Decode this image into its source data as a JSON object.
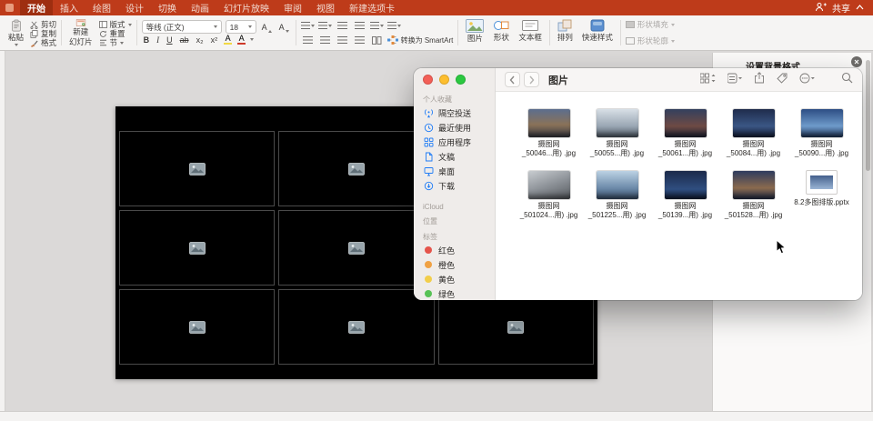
{
  "tabbar": {
    "tabs": [
      "开始",
      "插入",
      "绘图",
      "设计",
      "切换",
      "动画",
      "幻灯片放映",
      "审阅",
      "视图",
      "新建选项卡"
    ],
    "share": "共享"
  },
  "ribbon": {
    "paste": "粘贴",
    "cut": "剪切",
    "copy": "复制",
    "format_painter": "格式",
    "new_slide_line1": "新建",
    "new_slide_line2": "幻灯片",
    "layout": "版式",
    "reset": "重置",
    "section": "节",
    "font_name": "等线 (正文)",
    "font_size": "18",
    "size_up": "A",
    "size_down": "A",
    "bold": "B",
    "italic": "I",
    "underline": "U",
    "strike": "ab",
    "subscript": "x₂",
    "superscript": "x²",
    "highlight": "A",
    "font_color": "A",
    "smartart": "转换为 SmartArt",
    "picture": "图片",
    "shapes": "形状",
    "textbox": "文本框",
    "arrange": "排列",
    "quick_styles": "快速样式",
    "shape_fill": "形状填充",
    "shape_outline": "形状轮廓"
  },
  "finder": {
    "title": "图片",
    "sidebar": {
      "favorites_header": "个人收藏",
      "favorites": [
        {
          "label": "隔空投送"
        },
        {
          "label": "最近使用"
        },
        {
          "label": "应用程序"
        },
        {
          "label": "文稿"
        },
        {
          "label": "桌面"
        },
        {
          "label": "下载"
        }
      ],
      "icloud_header": "iCloud",
      "locations_header": "位置",
      "tags_header": "标签",
      "tags": [
        {
          "label": "红色",
          "color": "#E5544B"
        },
        {
          "label": "橙色",
          "color": "#F0A143"
        },
        {
          "label": "黄色",
          "color": "#F2CE4B"
        },
        {
          "label": "绿色",
          "color": "#57C255"
        }
      ]
    },
    "files": [
      {
        "name_line1": "摄图网",
        "name_line2": "_50046...用) .jpg"
      },
      {
        "name_line1": "摄图网",
        "name_line2": "_50055...用) .jpg"
      },
      {
        "name_line1": "摄图网",
        "name_line2": "_50061...用) .jpg"
      },
      {
        "name_line1": "摄图网",
        "name_line2": "_50084...用) .jpg"
      },
      {
        "name_line1": "摄图网",
        "name_line2": "_50090...用) .jpg"
      },
      {
        "name_line1": "摄图网",
        "name_line2": "_501024...用) .jpg"
      },
      {
        "name_line1": "摄图网",
        "name_line2": "_501225...用) .jpg"
      },
      {
        "name_line1": "摄图网",
        "name_line2": "_50139...用) .jpg"
      },
      {
        "name_line1": "摄图网",
        "name_line2": "_501528...用) .jpg"
      },
      {
        "name_line1": "8.2多图排版.pptx",
        "name_line2": ""
      }
    ]
  },
  "panel": {
    "title": "设置背景格式"
  },
  "colors": {
    "ribbon_accent": "#BE3B1A",
    "sidebar_icon_blue": "#1F7CF6"
  }
}
